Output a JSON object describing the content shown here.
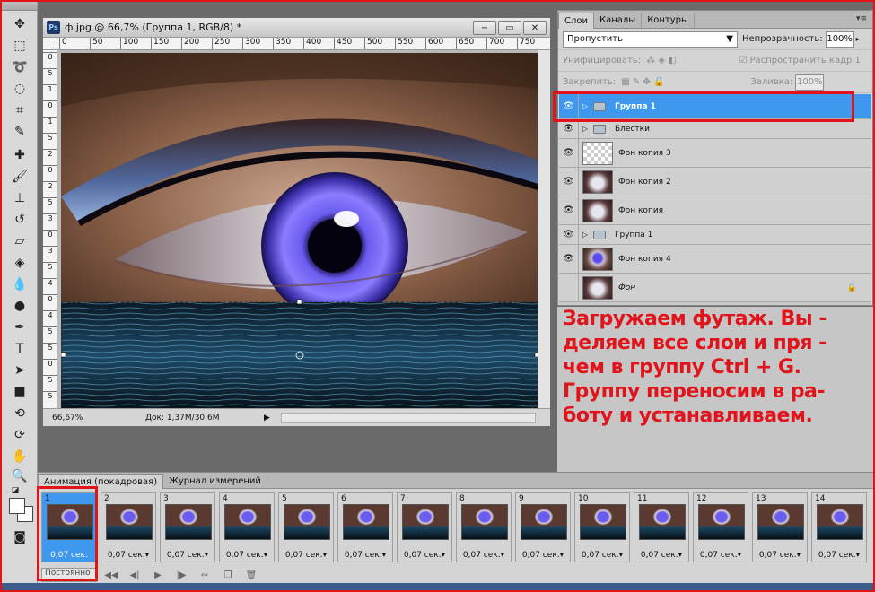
{
  "document": {
    "title": "ф.jpg @ 66,7% (Группа 1, RGB/8) *",
    "app_badge": "Ps",
    "zoom": "66,67%",
    "doc_info": "Док: 1,37M/30,6M",
    "ruler_h": [
      "0",
      "50",
      "100",
      "150",
      "200",
      "250",
      "300",
      "350",
      "400",
      "450",
      "500",
      "550",
      "600",
      "650",
      "700",
      "750"
    ],
    "ruler_v": [
      "0",
      "5",
      "1",
      "0",
      "1",
      "5",
      "2",
      "0",
      "2",
      "5",
      "3",
      "0",
      "3",
      "5",
      "4",
      "0",
      "4",
      "5",
      "5",
      "0",
      "5",
      "5"
    ],
    "window_buttons": {
      "minimize": "−",
      "restore": "▭",
      "close": "✕"
    }
  },
  "layers_panel": {
    "tabs": [
      "Слои",
      "Каналы",
      "Контуры"
    ],
    "blend_mode": "Пропустить",
    "opacity_label": "Непрозрачность:",
    "opacity": "100%",
    "unify_label": "Унифицировать:",
    "propagate_label": "Распространить кадр 1",
    "lock_label": "Закрепить:",
    "fill_label": "Заливка:",
    "fill": "100%",
    "layers": [
      {
        "name": "Группа 1",
        "type": "group",
        "visible": true,
        "selected": true
      },
      {
        "name": "Блестки",
        "type": "group",
        "visible": true,
        "selected": false
      },
      {
        "name": "Фон копия 3",
        "type": "layer",
        "visible": true,
        "selected": false
      },
      {
        "name": "Фон копия 2",
        "type": "layer",
        "visible": true,
        "selected": false
      },
      {
        "name": "Фон копия",
        "type": "layer",
        "visible": true,
        "selected": false
      },
      {
        "name": "Группа 1",
        "type": "group",
        "visible": true,
        "selected": false
      },
      {
        "name": "Фон копия 4",
        "type": "layer",
        "visible": true,
        "selected": false
      },
      {
        "name": "Фон",
        "type": "layer",
        "visible": false,
        "selected": false,
        "locked": true
      }
    ]
  },
  "annotation": {
    "lines": [
      "Загружаем футаж. Вы -",
      "деляем все слои и пря -",
      "чем в группу Ctrl + G.",
      "Группу переносим в ра-",
      "боту и устанавливаем."
    ]
  },
  "animation_panel": {
    "tabs": [
      "Анимация (покадровая)",
      "Журнал измерений"
    ],
    "loop": "Постоянно",
    "frames": [
      {
        "number": "1",
        "delay": "0,07 сек.",
        "selected": true
      },
      {
        "number": "2",
        "delay": "0,07 сек.▾"
      },
      {
        "number": "3",
        "delay": "0,07 сек.▾"
      },
      {
        "number": "4",
        "delay": "0,07 сек.▾"
      },
      {
        "number": "5",
        "delay": "0,07 сек.▾"
      },
      {
        "number": "6",
        "delay": "0,07 сек.▾"
      },
      {
        "number": "7",
        "delay": "0,07 сек.▾"
      },
      {
        "number": "8",
        "delay": "0,07 сек.▾"
      },
      {
        "number": "9",
        "delay": "0,07 сек.▾"
      },
      {
        "number": "10",
        "delay": "0,07 сек.▾"
      },
      {
        "number": "11",
        "delay": "0,07 сек.▾"
      },
      {
        "number": "12",
        "delay": "0,07 сек.▾"
      },
      {
        "number": "13",
        "delay": "0,07 сек.▾"
      },
      {
        "number": "14",
        "delay": "0,07 сек.▾"
      }
    ]
  },
  "colors": {
    "accent": "#3d98ee",
    "highlight": "#e1141c"
  }
}
